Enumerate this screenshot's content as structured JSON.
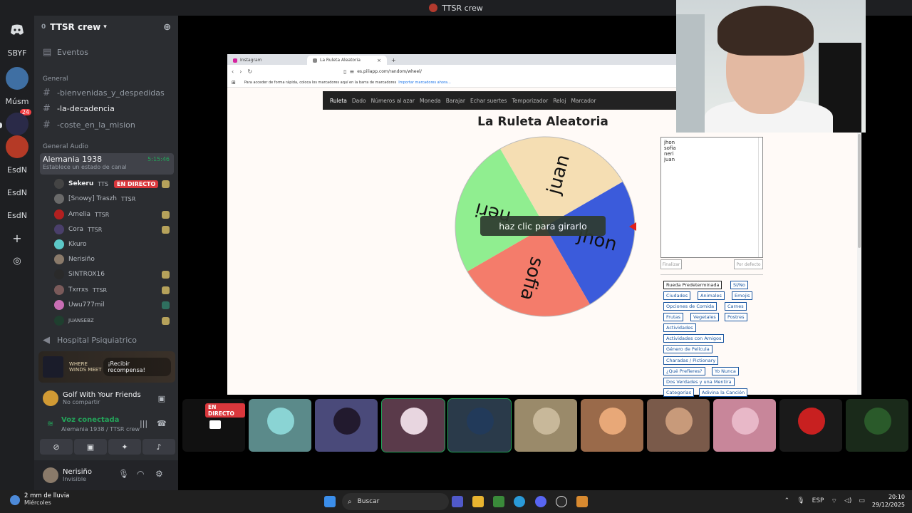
{
  "window": {
    "title": "TTSR crew"
  },
  "rail": {
    "items": [
      {
        "label": "SBYF"
      },
      {
        "label": "Músm",
        "badge": "24"
      },
      {
        "label": "EsdN"
      },
      {
        "label": "EsdN"
      },
      {
        "label": "EsdN"
      }
    ]
  },
  "server": {
    "name": "TTSR crew",
    "count": "0"
  },
  "channels": {
    "events": "Eventos",
    "category_general": "General",
    "text": [
      "-bienvenidas_y_despedidas",
      "-la-decadencia",
      "-coste_en_la_mision"
    ],
    "category_audio": "General Audio",
    "voice": {
      "name": "Alemania 1938",
      "time": "5:15:46",
      "status": "Establece un estado de canal"
    },
    "other_voice": "Hospital Psiquiatrico"
  },
  "members": [
    {
      "name": "Sekeru",
      "tag": "TTS",
      "live": "EN DIRECTO"
    },
    {
      "name": "[Snowy] Traszh",
      "tag": "TTSR"
    },
    {
      "name": "Amelia",
      "tag": "TTSR"
    },
    {
      "name": "Cora",
      "tag": "TTSR"
    },
    {
      "name": "Kkuro",
      "tag": ""
    },
    {
      "name": "Nerisiño",
      "tag": ""
    },
    {
      "name": "SINTROX16",
      "tag": ""
    },
    {
      "name": "Txrrxs",
      "tag": "TTSR"
    },
    {
      "name": "Uwu777mil",
      "tag": ""
    },
    {
      "name": "JUANSEBZ",
      "tag": ""
    }
  ],
  "promo": {
    "brand": "WHERE WINDS MEET",
    "button": "¡Recibir recompensa!"
  },
  "activity": {
    "title": "Golf With Your Friends",
    "sub": "No compartir"
  },
  "voice_panel": {
    "status": "Voz conectada",
    "location": "Alemania 1938 / TTSR crew"
  },
  "user": {
    "name": "Nerisiño",
    "status": "Invisible"
  },
  "browser": {
    "tabs": [
      {
        "label": "Instagram"
      },
      {
        "label": "La Ruleta Aleatoria"
      }
    ],
    "url": "es.piliapp.com/random/wheel/",
    "bookmark_hint": "Para acceder de forma rápida, coloca los marcadores aquí en la barra de marcadores",
    "bookmark_link": "Importar marcadores ahora..."
  },
  "site": {
    "nav": [
      "Ruleta",
      "Dado",
      "Números al azar",
      "Moneda",
      "Barajar",
      "Echar suertes",
      "Temporizador",
      "Reloj",
      "Marcador"
    ],
    "title": "La Ruleta Aleatoria",
    "spin_hint": "haz clic para girarlo",
    "names": [
      "jhon",
      "sofia",
      "neri",
      "juan"
    ],
    "btn_finish": "Finalizar",
    "btn_default": "Por defecto",
    "presets": [
      "Rueda Predeterminada",
      "Sí/No",
      "Ciudades",
      "Animales",
      "Emojis",
      "Opciones de Comida",
      "Carnes",
      "Frutas",
      "Vegetales",
      "Postres",
      "Actividades",
      "Actividades con Amigos",
      "Género de Película",
      "Charadas / Pictionary",
      "¿Qué Prefieres?",
      "Yo Nunca",
      "Dos Verdades y una Mentira",
      "Categorías",
      "Adivina la Canción"
    ]
  },
  "wheel": {
    "segments": [
      {
        "label": "juan",
        "color": "#f5deb3"
      },
      {
        "label": "jhon",
        "color": "#3b5bdb"
      },
      {
        "label": "sofia",
        "color": "#f47c6b"
      },
      {
        "label": "neri",
        "color": "#90ee90"
      }
    ],
    "pointer_color": "#e0201a"
  },
  "tiles": {
    "live_label": "EN DIRECTO"
  },
  "taskbar": {
    "weather": "2 mm de lluvia",
    "weather_sub": "Miércoles",
    "search": "Buscar",
    "lang": "ESP",
    "time": "20:10",
    "date": "29/12/2025"
  }
}
